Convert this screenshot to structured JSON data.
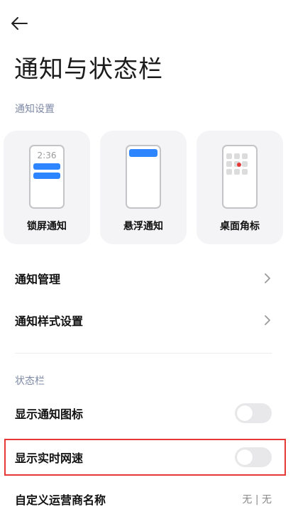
{
  "header": {
    "title": "通知与状态栏"
  },
  "sections": {
    "notification_settings": "通知设置",
    "status_bar": "状态栏"
  },
  "cards": [
    {
      "label": "锁屏通知",
      "time": "2:36"
    },
    {
      "label": "悬浮通知"
    },
    {
      "label": "桌面角标"
    }
  ],
  "rows": {
    "notification_management": "通知管理",
    "notification_style": "通知样式设置",
    "show_notification_icons": "显示通知图标",
    "show_realtime_speed": "显示实时网速",
    "custom_carrier_name": "自定义运营商名称",
    "custom_carrier_value": "无 | 无"
  },
  "toggles": {
    "show_notification_icons": false,
    "show_realtime_speed": false
  },
  "colors": {
    "accent_blue": "#2d86ff",
    "badge_red": "#e53935",
    "highlight_red": "#e53935",
    "section_label": "#7f8aa6"
  },
  "icons": {
    "back": "arrow-left-icon",
    "chevron": "chevron-right-icon"
  }
}
